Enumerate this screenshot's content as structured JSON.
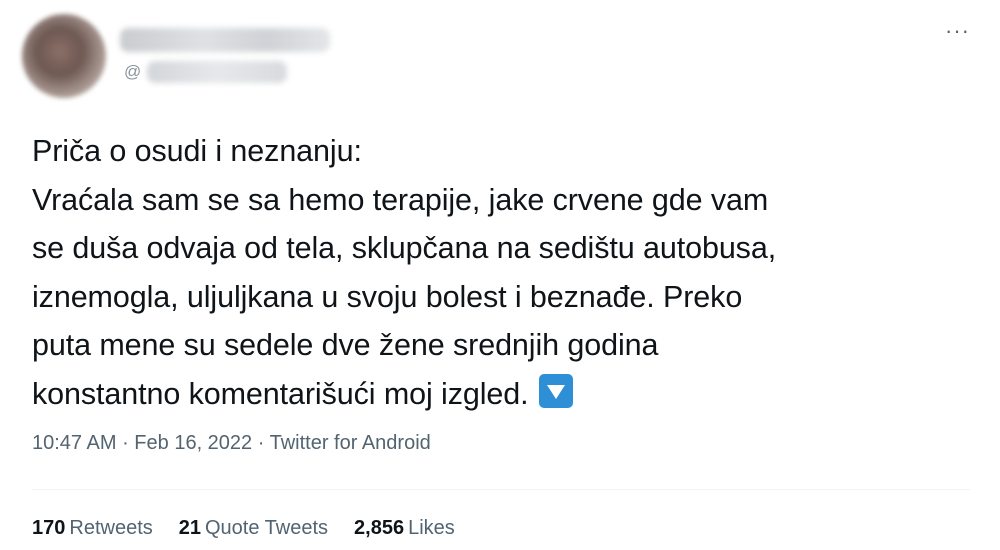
{
  "tweet": {
    "handle_prefix": "@",
    "text_lines": [
      "Priča o osudi i neznanju:",
      "Vraćala sam se sa hemo terapije, jake crvene gde vam",
      "se duša odvaja od tela, sklupčana na sedištu autobusa,",
      "iznemogla, uljuljkana u svoju bolest i beznađe. Preko",
      "puta mene su sedele dve žene srednjih godina",
      "konstantno komentarišući moj izgled."
    ],
    "emoji_icon": "down-arrow-button-icon",
    "more_icon": "···",
    "time": "10:47 AM",
    "date": "Feb 16, 2022",
    "source": "Twitter for Android",
    "separator": " · "
  },
  "stats": {
    "retweets_count": "170",
    "retweets_label": "Retweets",
    "quote_count": "21",
    "quote_label": "Quote Tweets",
    "likes_count": "2,856",
    "likes_label": "Likes"
  },
  "colors": {
    "text": "#0f1419",
    "secondary": "#536471",
    "emoji_blue": "#2f8fd6"
  }
}
